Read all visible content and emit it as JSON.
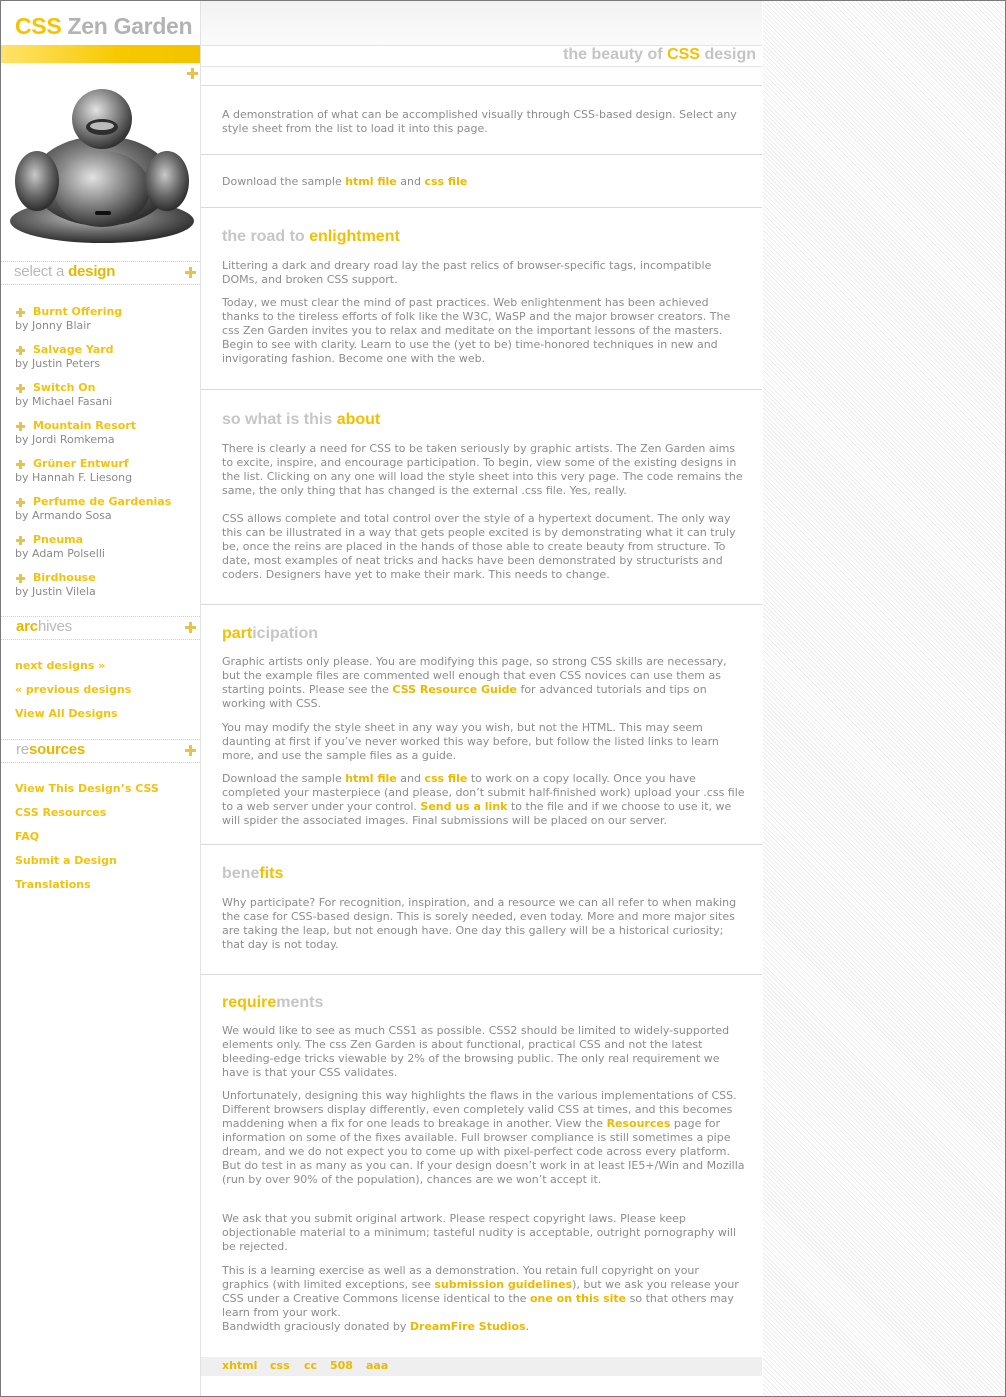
{
  "logo": {
    "part1": "CSS",
    "part2": "Zen Garden"
  },
  "tagline": {
    "pre": "the beauty of",
    "accent": "CSS",
    "post": "design"
  },
  "select": {
    "grey": "select a",
    "yellow": "design"
  },
  "designs": [
    {
      "name": "Burnt Offering",
      "by": "by Jonny Blair"
    },
    {
      "name": "Salvage Yard",
      "by": "by Justin Peters"
    },
    {
      "name": "Switch On",
      "by": "by Michael Fasani"
    },
    {
      "name": "Mountain Resort",
      "by": "by Jordi Romkema"
    },
    {
      "name": "Grüner Entwurf",
      "by": "by Hannah F. Liesong"
    },
    {
      "name": "Perfume de Gardenias",
      "by": "by Armando Sosa"
    },
    {
      "name": "Pneuma",
      "by": "by Adam Polselli"
    },
    {
      "name": "Birdhouse",
      "by": "by Justin Vilela"
    }
  ],
  "archives": {
    "yellow": "arc",
    "yellow2": "h",
    "grey": "ives",
    "label_full": "archives",
    "next": "next designs »",
    "prev": "« previous designs",
    "all": "View All Designs"
  },
  "resources": {
    "grey": "re",
    "yellow": "sources",
    "links": [
      "View This Design’s CSS",
      "CSS Resources",
      "FAQ",
      "Submit a Design",
      "Translations"
    ]
  },
  "intro": {
    "summary": "A demonstration of what can be accomplished visually through CSS-based design. Select any style sheet from the list to load it into this page.",
    "download_pre": "Download the sample",
    "html_file": "html file",
    "and": "and",
    "css_file": "css file"
  },
  "road": {
    "h_grey": "the road to",
    "h_yellow": "enlightment",
    "p1": "Littering a dark and dreary road lay the past relics of browser-specific tags, incompatible DOMs, and broken CSS support.",
    "p2": "Today, we must clear the mind of past practices. Web enlightenment has been achieved thanks to the tireless efforts of folk like the W3C, WaSP and the major browser creators. The css Zen Garden invites you to relax and meditate on the important lessons of the masters. Begin to see with clarity. Learn to use the (yet to be) time-honored techniques in new and invigorating fashion. Become one with the web."
  },
  "about": {
    "h_grey": "so what is this",
    "h_yellow": "about",
    "p1": "There is clearly a need for CSS to be taken seriously by graphic artists. The Zen Garden aims to excite, inspire, and encourage participation. To begin, view some of the existing designs in the list. Clicking on any one will load the style sheet into this very page. The code remains the same, the only thing that has changed is the external .css file. Yes, really.",
    "p2": "CSS allows complete and total control over the style of a hypertext document. The only way this can be illustrated in a way that gets people excited is by demonstrating what it can truly be, once the reins are placed in the hands of those able to create beauty from structure. To date, most examples of neat tricks and hacks have been demonstrated by structurists and coders. Designers have yet to make their mark. This needs to change."
  },
  "participation": {
    "h_yellow": "part",
    "h_grey": "icipation",
    "p1_pre": "Graphic artists only please. You are modifying this page, so strong CSS skills are necessary, but the example files are commented well enough that even CSS novices can use them as starting points. Please see the",
    "p1_link": "CSS Resource Guide",
    "p1_post": "for advanced tutorials and tips on working with CSS.",
    "p2": "You may modify the style sheet in any way you wish, but not the HTML. This may seem daunting at first if you’ve never worked this way before, but follow the listed links to learn more, and use the sample files as a guide.",
    "p3_a": "Download the sample",
    "p3_html": "html file",
    "p3_and": "and",
    "p3_css": "css file",
    "p3_b": "to work on a copy locally. Once you have completed your masterpiece (and please, don’t submit half-finished work) upload your .css file to a web server under your control.",
    "p3_link": "Send us a link",
    "p3_c": "to the file and if we choose to use it, we will spider the associated images. Final submissions will be placed on our server."
  },
  "benefits": {
    "h_grey": "bene",
    "h_yellow": "fits",
    "p1": "Why participate? For recognition, inspiration, and a resource we can all refer to when making the case for CSS-based design. This is sorely needed, even today. More and more major sites are taking the leap, but not enough have. One day this gallery will be a historical curiosity; that day is not today."
  },
  "requirements": {
    "h_yellow": "require",
    "h_grey": "ments",
    "p1": "We would like to see as much CSS1 as possible. CSS2 should be limited to widely-supported elements only. The css Zen Garden is about functional, practical CSS and not the latest bleeding-edge tricks viewable by 2% of the browsing public. The only real requirement we have is that your CSS validates.",
    "p2_a": "Unfortunately, designing this way highlights the flaws in the various implementations of CSS. Different browsers display differently, even completely valid CSS at times, and this becomes maddening when a fix for one leads to breakage in another. View the",
    "p2_link": "Resources",
    "p2_b": "page for information on some of the fixes available. Full browser compliance is still sometimes a pipe dream, and we do not expect you to come up with pixel-perfect code across every platform. But do test in as many as you can. If your design doesn’t work in at least IE5+/Win and Mozilla (run by over 90% of the population), chances are we won’t accept it.",
    "p3": "We ask that you submit original artwork. Please respect copyright laws. Please keep objectionable material to a minimum; tasteful nudity is acceptable, outright pornography will be rejected.",
    "p4_a": "This is a learning exercise as well as a demonstration. You retain full copyright on your graphics (with limited exceptions, see",
    "p4_link1": "submission guidelines",
    "p4_b": "), but we ask you release your CSS under a Creative Commons license identical to the",
    "p4_link2": "one on this site",
    "p4_c": "so that others may learn from your work.",
    "p5_a": "Bandwidth graciously donated by",
    "p5_link": "DreamFire Studios",
    "p5_b": "."
  },
  "footer": {
    "links": [
      "xhtml",
      "css",
      "cc",
      "508",
      "aaa"
    ]
  }
}
